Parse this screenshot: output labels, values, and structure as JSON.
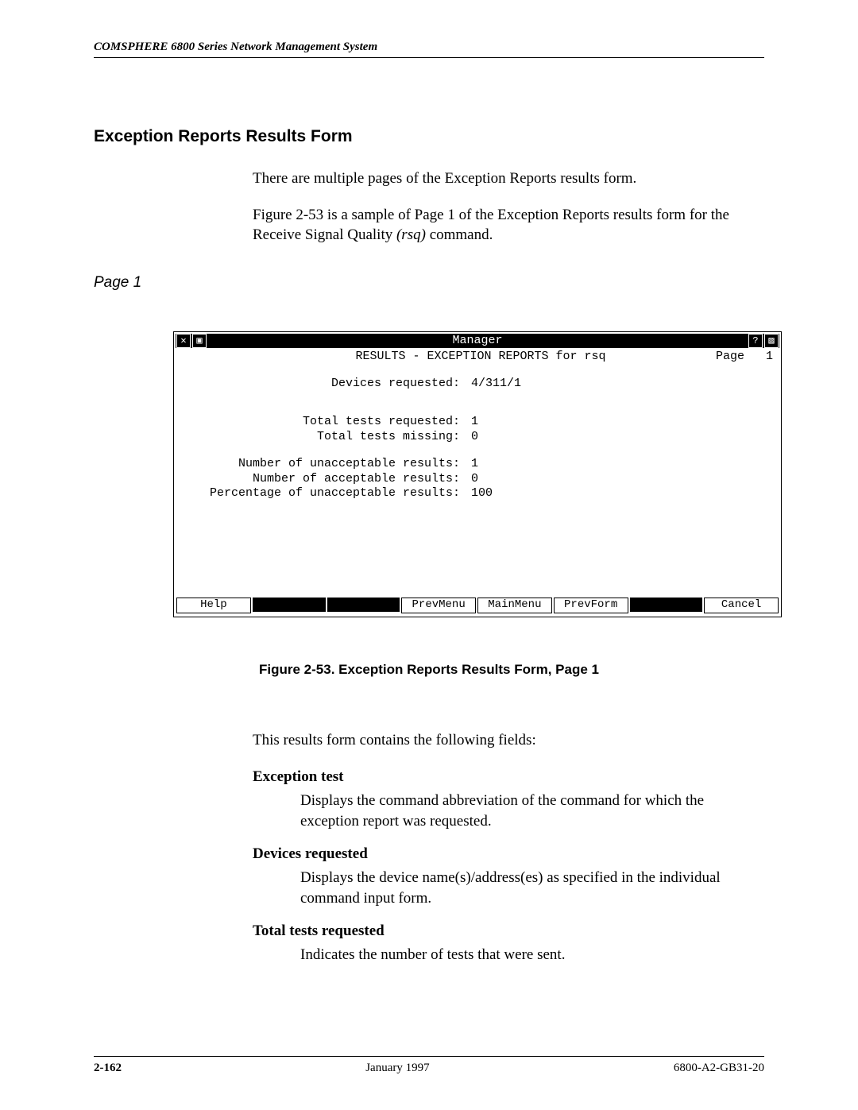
{
  "header": {
    "running_head": "COMSPHERE 6800 Series Network Management System"
  },
  "section": {
    "title": "Exception Reports Results Form",
    "p1": "There are multiple pages of the Exception Reports results form.",
    "p2a": "Figure 2-53 is a sample of Page 1 of the Exception Reports results form for the Receive Signal Quality ",
    "p2_cmd": "(rsq)",
    "p2b": " command.",
    "page_label": "Page 1"
  },
  "terminal": {
    "titlebar": "Manager",
    "header_line": "RESULTS - EXCEPTION REPORTS for rsq",
    "page_label": "Page",
    "page_num": "1",
    "rows": [
      {
        "label": "Devices requested:",
        "value": "4/311/1"
      }
    ],
    "rows2": [
      {
        "label": "Total tests requested:",
        "value": "1"
      },
      {
        "label": "Total tests missing:",
        "value": "0"
      }
    ],
    "rows3": [
      {
        "label": "Number of unacceptable results:",
        "value": "1"
      },
      {
        "label": "Number of acceptable results:",
        "value": "0"
      },
      {
        "label": "Percentage of unacceptable results:",
        "value": "100"
      }
    ],
    "fkeys": {
      "f1": "Help",
      "f4": "PrevMenu",
      "f5": "MainMenu",
      "f6": "PrevForm",
      "f8": "Cancel"
    },
    "icons": {
      "close": "✕",
      "pin": "▣",
      "help": "?",
      "resize": "▨"
    }
  },
  "caption": "Figure 2-53. Exception Reports Results Form, Page 1",
  "fields_intro": "This results form contains the following fields:",
  "fields": [
    {
      "term": "Exception test",
      "def": "Displays the command abbreviation of the command for which the exception report was requested."
    },
    {
      "term": "Devices requested",
      "def": "Displays the device name(s)/address(es) as specified in the individual command input form."
    },
    {
      "term": "Total tests requested",
      "def": "Indicates the number of tests that were sent."
    }
  ],
  "footer": {
    "page": "2-162",
    "date": "January 1997",
    "docnum": "6800-A2-GB31-20"
  }
}
